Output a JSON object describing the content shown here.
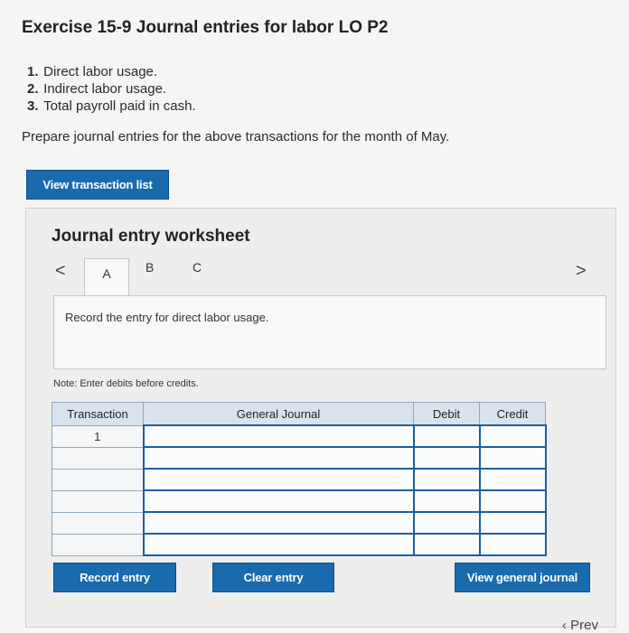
{
  "header": {
    "title": "Exercise 15-9 Journal entries for labor LO P2"
  },
  "requirements": [
    {
      "num": "1.",
      "text": "Direct labor usage."
    },
    {
      "num": "2.",
      "text": "Indirect labor usage."
    },
    {
      "num": "3.",
      "text": "Total payroll paid in cash."
    }
  ],
  "instruction": "Prepare journal entries for the above transactions for the month of May.",
  "buttons": {
    "view_transaction_list": "View transaction list",
    "record_entry": "Record entry",
    "clear_entry": "Clear entry",
    "view_general_journal": "View general journal"
  },
  "worksheet": {
    "title": "Journal entry worksheet",
    "nav_prev": "<",
    "nav_next": ">",
    "tabs": [
      "A",
      "B",
      "C"
    ],
    "active_tab": "A",
    "prompt": "Record the entry for direct labor usage.",
    "note": "Note: Enter debits before credits."
  },
  "table": {
    "headers": [
      "Transaction",
      "General Journal",
      "Debit",
      "Credit"
    ],
    "rows": [
      {
        "transaction": "1",
        "general_journal": "",
        "debit": "",
        "credit": ""
      },
      {
        "transaction": "",
        "general_journal": "",
        "debit": "",
        "credit": ""
      },
      {
        "transaction": "",
        "general_journal": "",
        "debit": "",
        "credit": ""
      },
      {
        "transaction": "",
        "general_journal": "",
        "debit": "",
        "credit": ""
      },
      {
        "transaction": "",
        "general_journal": "",
        "debit": "",
        "credit": ""
      },
      {
        "transaction": "",
        "general_journal": "",
        "debit": "",
        "credit": ""
      }
    ]
  },
  "footer": {
    "prev_label": "‹ Prev"
  },
  "colors": {
    "button_blue": "#1a6aae",
    "table_header": "#d9e3ee",
    "input_border": "#1c5f9e"
  }
}
